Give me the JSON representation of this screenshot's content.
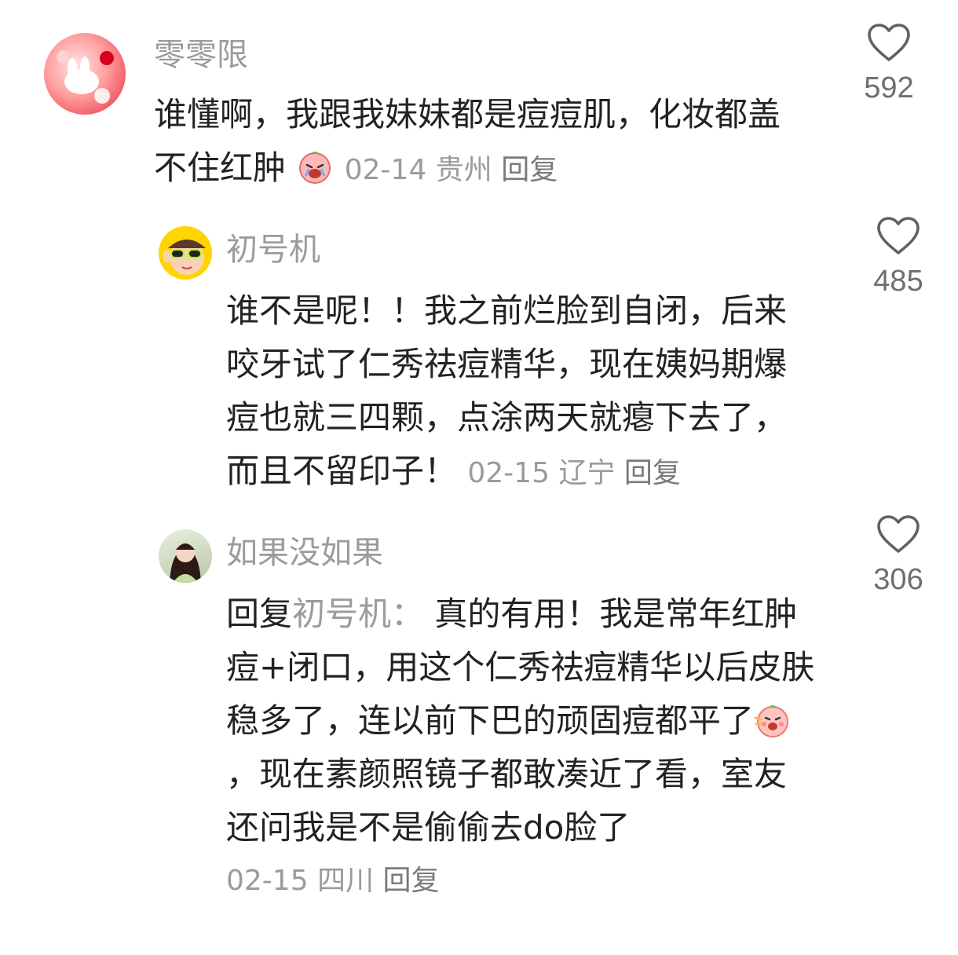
{
  "comments": [
    {
      "username": "零零限",
      "text": "谁懂啊，我跟我妹妹都是痘痘肌，化妆都盖不住红肿",
      "emoji": "crying-face-emoji",
      "date": "02-14",
      "location": "贵州",
      "reply_label": "回复",
      "likes": "592"
    },
    {
      "username": "初号机",
      "text": "谁不是呢！！我之前烂脸到自闭，后来咬牙试了仁秀祛痘精华，现在姨妈期爆痘也就三四颗，点涂两天就瘪下去了，而且不留印子！",
      "date": "02-15",
      "location": "辽宁",
      "reply_label": "回复",
      "likes": "485"
    },
    {
      "username": "如果没如果",
      "reply_prefix": "回复",
      "reply_target": "初号机：",
      "text_before_emoji": "真的有用！我是常年红肿痘+闭口，用这个仁秀祛痘精华以后皮肤稳多了，连以前下巴的顽固痘都平了",
      "emoji": "peach-face-emoji",
      "text_after_emoji": "，现在素颜照镜子都敢凑近了看，室友还问我是不是偷偷去do脸了",
      "date": "02-15",
      "location": "四川",
      "reply_label": "回复",
      "likes": "306"
    }
  ],
  "icons": {
    "like": "heart-outline-icon"
  },
  "colors": {
    "text": "#222222",
    "secondary": "#9b9b9b",
    "background": "#ffffff"
  }
}
